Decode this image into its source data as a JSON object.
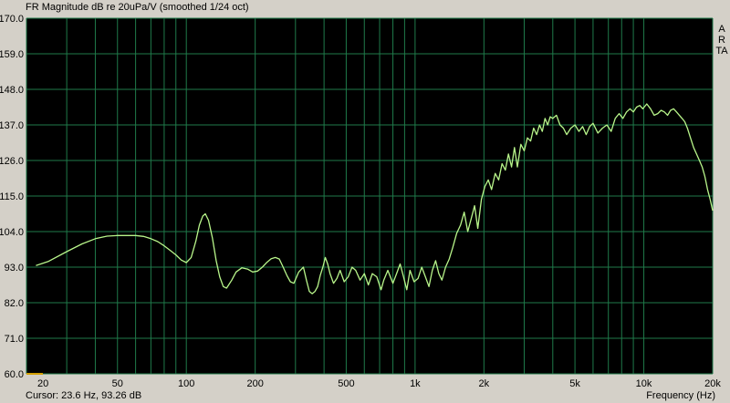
{
  "window": {
    "title": "FR Magnitude dB re 20uPa/V (smoothed 1/24 oct)",
    "brand": "ARTA"
  },
  "status": {
    "cursor": "Cursor: 23.6 Hz, 93.26 dB",
    "xlabel": "Frequency (Hz)"
  },
  "chart_data": {
    "type": "line",
    "title": "FR Magnitude dB re 20uPa/V (smoothed 1/24 oct)",
    "xlabel": "Frequency (Hz)",
    "ylabel": "",
    "xscale": "log",
    "xlim": [
      20,
      20000
    ],
    "ylim": [
      60,
      170
    ],
    "grid": true,
    "background": "#000000",
    "grid_color": "#1f7a4a",
    "line_color": "#b8f58a",
    "y_ticks": [
      "60.0",
      "71.0",
      "82.0",
      "93.0",
      "104.0",
      "115.0",
      "126.0",
      "137.0",
      "148.0",
      "159.0",
      "170.0"
    ],
    "x_ticks": [
      {
        "value": 20,
        "label": "20"
      },
      {
        "value": 50,
        "label": "50"
      },
      {
        "value": 100,
        "label": "100"
      },
      {
        "value": 200,
        "label": "200"
      },
      {
        "value": 500,
        "label": "500"
      },
      {
        "value": 1000,
        "label": "1k"
      },
      {
        "value": 2000,
        "label": "2k"
      },
      {
        "value": 5000,
        "label": "5k"
      },
      {
        "value": 10000,
        "label": "10k"
      },
      {
        "value": 20000,
        "label": "20k"
      }
    ],
    "series": [
      {
        "points": [
          [
            22,
            93.5
          ],
          [
            25,
            94.8
          ],
          [
            30,
            97.8
          ],
          [
            35,
            100.2
          ],
          [
            40,
            101.8
          ],
          [
            45,
            102.6
          ],
          [
            50,
            102.8
          ],
          [
            55,
            102.8
          ],
          [
            60,
            102.8
          ],
          [
            65,
            102.5
          ],
          [
            70,
            101.8
          ],
          [
            75,
            100.9
          ],
          [
            80,
            99.6
          ],
          [
            85,
            98.2
          ],
          [
            90,
            96.8
          ],
          [
            95,
            95.2
          ],
          [
            100,
            94.4
          ],
          [
            105,
            96
          ],
          [
            110,
            101
          ],
          [
            114,
            106
          ],
          [
            118,
            108.8
          ],
          [
            121,
            109.5
          ],
          [
            125,
            107.5
          ],
          [
            130,
            102
          ],
          [
            135,
            95
          ],
          [
            140,
            90
          ],
          [
            145,
            87
          ],
          [
            150,
            86.5
          ],
          [
            158,
            89
          ],
          [
            165,
            91.5
          ],
          [
            175,
            92.8
          ],
          [
            185,
            92.4
          ],
          [
            195,
            91.5
          ],
          [
            205,
            91.8
          ],
          [
            215,
            93
          ],
          [
            225,
            94.5
          ],
          [
            235,
            95.6
          ],
          [
            245,
            96
          ],
          [
            255,
            95.5
          ],
          [
            265,
            93
          ],
          [
            275,
            90.5
          ],
          [
            285,
            88.5
          ],
          [
            295,
            88
          ],
          [
            310,
            91.5
          ],
          [
            325,
            93
          ],
          [
            335,
            89
          ],
          [
            345,
            85.5
          ],
          [
            355,
            84.8
          ],
          [
            365,
            85.5
          ],
          [
            375,
            87
          ],
          [
            385,
            90.5
          ],
          [
            395,
            93
          ],
          [
            405,
            96
          ],
          [
            415,
            94
          ],
          [
            425,
            91
          ],
          [
            440,
            88
          ],
          [
            455,
            89.5
          ],
          [
            470,
            92
          ],
          [
            490,
            88.5
          ],
          [
            510,
            90
          ],
          [
            530,
            93
          ],
          [
            550,
            92
          ],
          [
            575,
            89
          ],
          [
            600,
            91
          ],
          [
            625,
            87.5
          ],
          [
            650,
            91
          ],
          [
            680,
            90
          ],
          [
            710,
            86
          ],
          [
            730,
            89
          ],
          [
            760,
            92
          ],
          [
            800,
            88
          ],
          [
            830,
            91
          ],
          [
            860,
            94
          ],
          [
            890,
            90
          ],
          [
            920,
            86
          ],
          [
            950,
            92
          ],
          [
            990,
            88.5
          ],
          [
            1030,
            89.5
          ],
          [
            1070,
            93
          ],
          [
            1110,
            90
          ],
          [
            1150,
            87
          ],
          [
            1190,
            92
          ],
          [
            1230,
            95
          ],
          [
            1270,
            91
          ],
          [
            1310,
            89
          ],
          [
            1360,
            93
          ],
          [
            1410,
            95.5
          ],
          [
            1460,
            99
          ],
          [
            1520,
            103.5
          ],
          [
            1580,
            106
          ],
          [
            1640,
            110
          ],
          [
            1700,
            104
          ],
          [
            1760,
            108
          ],
          [
            1820,
            112
          ],
          [
            1880,
            105
          ],
          [
            1950,
            114
          ],
          [
            2020,
            118
          ],
          [
            2090,
            120
          ],
          [
            2160,
            117
          ],
          [
            2240,
            122
          ],
          [
            2320,
            120
          ],
          [
            2400,
            125
          ],
          [
            2480,
            123
          ],
          [
            2560,
            128
          ],
          [
            2640,
            124
          ],
          [
            2720,
            130
          ],
          [
            2800,
            124
          ],
          [
            2900,
            131
          ],
          [
            3000,
            129
          ],
          [
            3100,
            133
          ],
          [
            3200,
            132
          ],
          [
            3300,
            136
          ],
          [
            3400,
            134
          ],
          [
            3500,
            137
          ],
          [
            3600,
            135
          ],
          [
            3700,
            139
          ],
          [
            3800,
            137
          ],
          [
            3900,
            139.5
          ],
          [
            4000,
            139
          ],
          [
            4150,
            140
          ],
          [
            4300,
            137
          ],
          [
            4450,
            136
          ],
          [
            4600,
            134
          ],
          [
            4800,
            136
          ],
          [
            5000,
            137
          ],
          [
            5200,
            135
          ],
          [
            5400,
            136.5
          ],
          [
            5600,
            134
          ],
          [
            5800,
            136.5
          ],
          [
            6000,
            137.5
          ],
          [
            6300,
            134.5
          ],
          [
            6600,
            136
          ],
          [
            6900,
            137
          ],
          [
            7200,
            135
          ],
          [
            7500,
            139
          ],
          [
            7800,
            140.5
          ],
          [
            8100,
            139
          ],
          [
            8400,
            141
          ],
          [
            8700,
            142
          ],
          [
            9000,
            141
          ],
          [
            9300,
            142.5
          ],
          [
            9600,
            143
          ],
          [
            9900,
            142
          ],
          [
            10300,
            143.5
          ],
          [
            10700,
            142
          ],
          [
            11100,
            140
          ],
          [
            11500,
            140.5
          ],
          [
            11900,
            141.5
          ],
          [
            12300,
            141
          ],
          [
            12700,
            140
          ],
          [
            13100,
            141.5
          ],
          [
            13500,
            142
          ],
          [
            13900,
            141
          ],
          [
            14300,
            140
          ],
          [
            14700,
            139
          ],
          [
            15100,
            138
          ],
          [
            15500,
            136
          ],
          [
            16000,
            133
          ],
          [
            16500,
            130
          ],
          [
            17000,
            128
          ],
          [
            17500,
            126
          ],
          [
            18000,
            124
          ],
          [
            18500,
            121
          ],
          [
            19000,
            117
          ],
          [
            19500,
            114
          ],
          [
            20000,
            110.5
          ]
        ]
      }
    ]
  }
}
